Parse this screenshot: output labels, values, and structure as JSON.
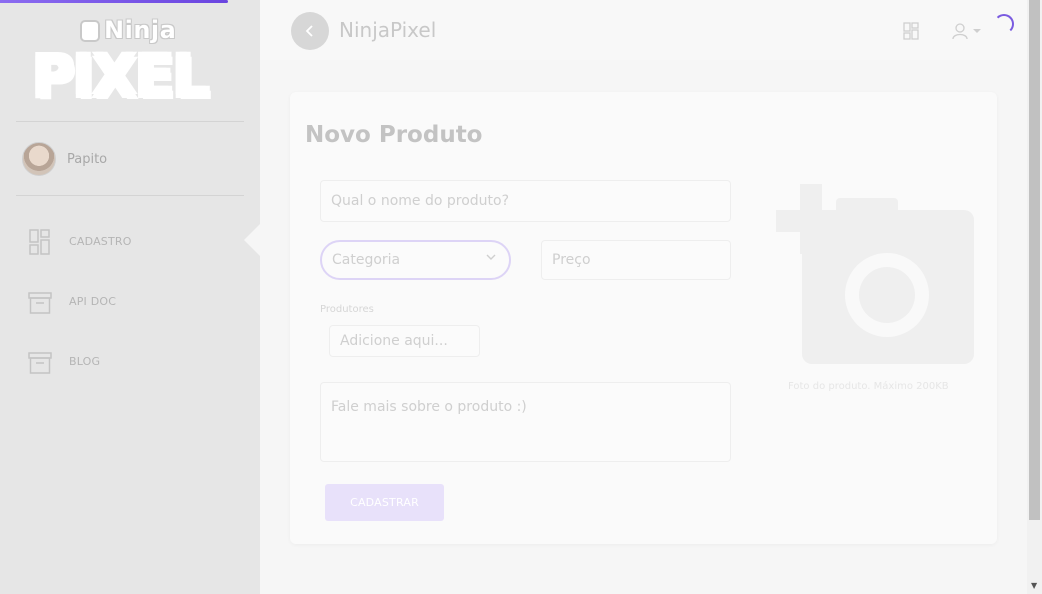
{
  "brand": {
    "logo_top": "Ninja",
    "logo_bottom": "PIXEL",
    "header_title": "NinjaPixel"
  },
  "user": {
    "name": "Papito"
  },
  "sidebar": {
    "items": [
      {
        "label": "CADASTRO",
        "icon": "dashboard-icon",
        "active": true
      },
      {
        "label": "API DOC",
        "icon": "archive-icon",
        "active": false
      },
      {
        "label": "BLOG",
        "icon": "archive-icon",
        "active": false
      }
    ]
  },
  "header": {
    "back_icon": "chevron-left-icon",
    "right_icons": [
      "dashboard-icon",
      "user-icon"
    ]
  },
  "form": {
    "title": "Novo Produto",
    "name_placeholder": "Qual o nome do produto?",
    "category_placeholder": "Categoria",
    "price_placeholder": "Preço",
    "producers_label": "Produtores",
    "producers_placeholder": "Adicione aqui...",
    "description_placeholder": "Fale mais sobre o produto :)",
    "submit_label": "CADASTRAR",
    "photo_hint": "Foto do produto. Máximo 200KB"
  },
  "colors": {
    "accent": "#7a5be0",
    "sidebar_bg": "#e6e6e6",
    "page_bg": "#f6f6f6"
  }
}
